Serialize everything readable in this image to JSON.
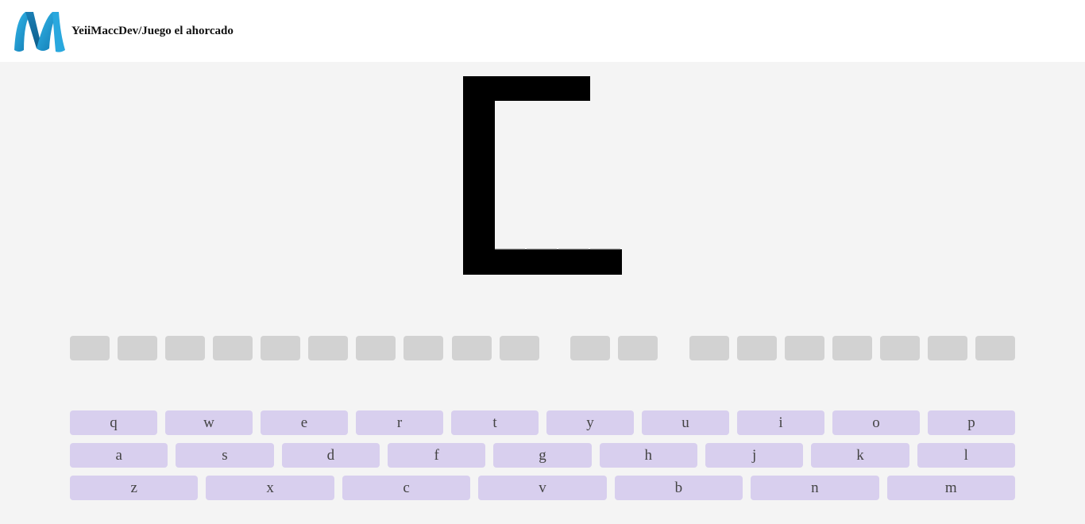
{
  "header": {
    "logo_icon": "m-logo-icon",
    "brand": "YeiiMaccDev/Juego el ahorcado"
  },
  "colors": {
    "background": "#f4f4f4",
    "header": "#ffffff",
    "slot": "#d2d2d2",
    "key": "#d8cfee",
    "gallows": "#000000",
    "logo": "#29a8de"
  },
  "word": {
    "groups": [
      10,
      2,
      7
    ],
    "letters_revealed": 0
  },
  "keyboard": {
    "rows": [
      [
        "q",
        "w",
        "e",
        "r",
        "t",
        "y",
        "u",
        "i",
        "o",
        "p"
      ],
      [
        "a",
        "s",
        "d",
        "f",
        "g",
        "h",
        "j",
        "k",
        "l"
      ],
      [
        "z",
        "x",
        "c",
        "v",
        "b",
        "n",
        "m"
      ]
    ]
  }
}
